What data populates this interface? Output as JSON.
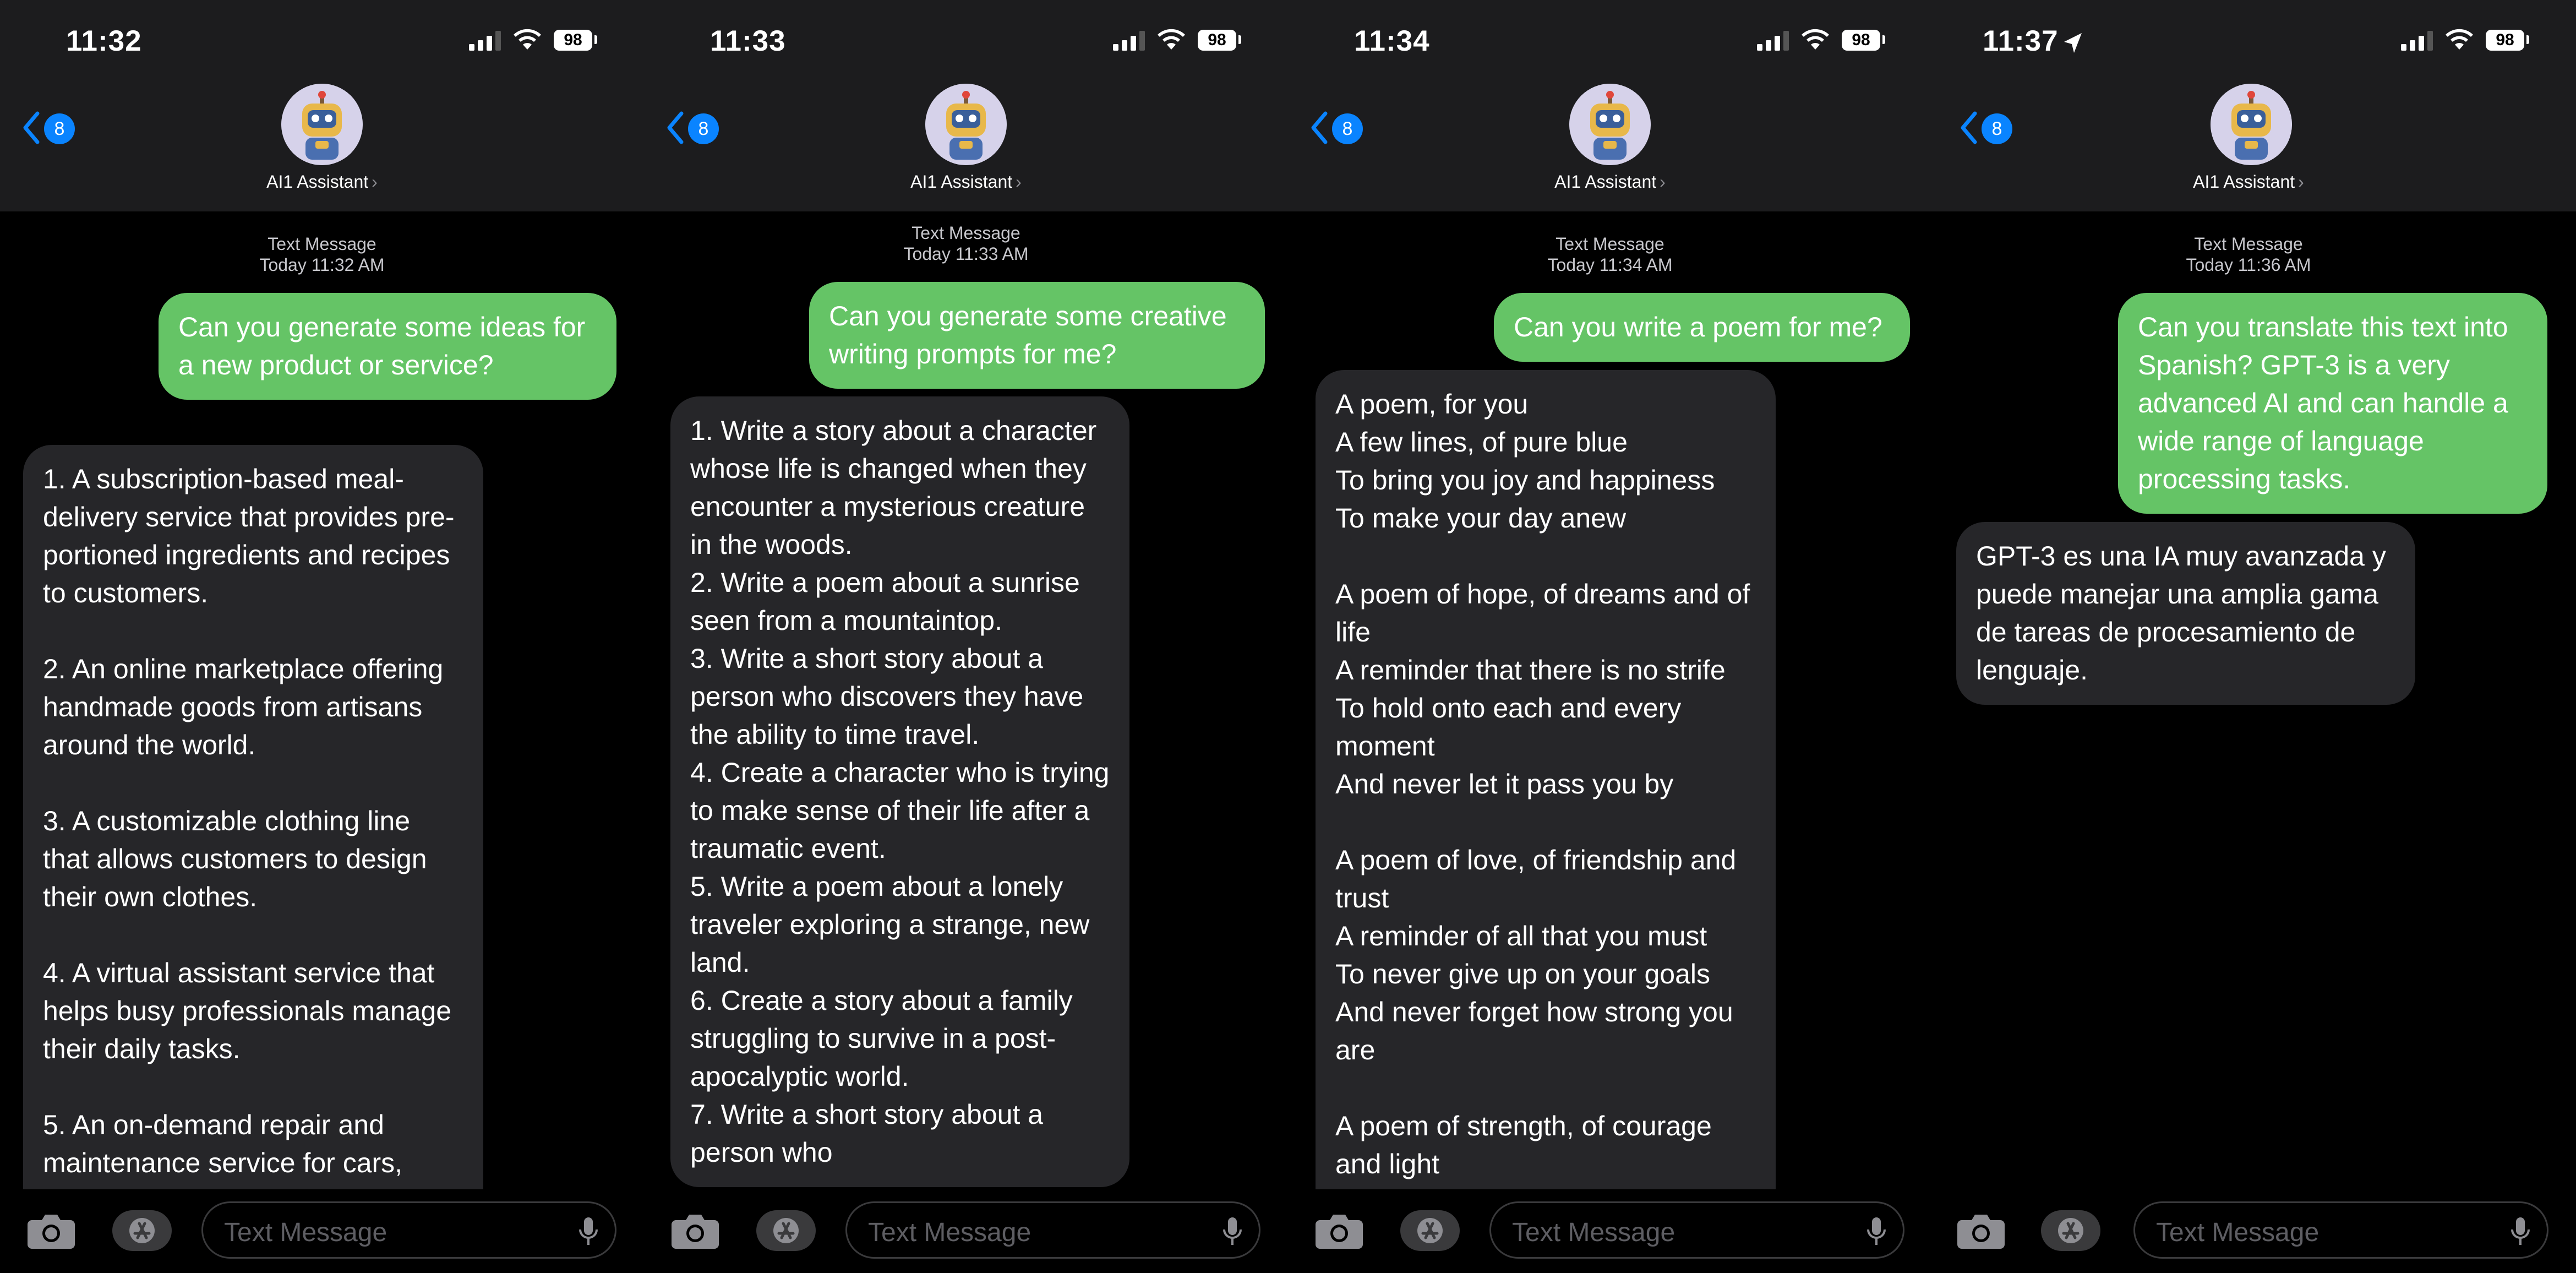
{
  "panels": [
    {
      "time": "11:32",
      "battery": "98",
      "unread": "8",
      "contact": "AI1 Assistant",
      "stamp_label": "Text Message",
      "stamp_time": "Today 11:32 AM",
      "outgoing": "Can you generate some ideas for a new product or service?",
      "incoming": "1. A subscription-based meal-delivery service that provides pre-portioned ingredients and recipes to customers.\n\n2. An online marketplace offering handmade goods from artisans around the world.\n\n3. A customizable clothing line that allows customers to design their own clothes.\n\n4. A virtual assistant service that helps busy professionals manage their daily tasks.\n\n5. An on-demand repair and maintenance service for cars, appliances, and other household",
      "placeholder": "Text Message"
    },
    {
      "time": "11:33",
      "battery": "98",
      "unread": "8",
      "contact": "AI1 Assistant",
      "stamp_label": "Text Message",
      "stamp_time": "Today 11:33 AM",
      "outgoing": "Can you generate some creative writing prompts for me?",
      "incoming": "1. Write a story about a character whose life is changed when they encounter a mysterious creature in the woods.\n2. Write a poem about a sunrise seen from a mountaintop.\n3. Write a short story about a person who discovers they have the ability to time travel.\n4. Create a character who is trying to make sense of their life after a traumatic event.\n5. Write a poem about a lonely traveler exploring a strange, new land.\n6. Create a story about a family struggling to survive in a post-apocalyptic world.\n7. Write a short story about a person who",
      "placeholder": "Text Message"
    },
    {
      "time": "11:34",
      "battery": "98",
      "unread": "8",
      "contact": "AI1 Assistant",
      "stamp_label": "Text Message",
      "stamp_time": "Today 11:34 AM",
      "outgoing": "Can you write a poem for me?",
      "incoming": "A poem, for you\nA few lines, of pure blue\nTo bring you joy and happiness\nTo make your day anew\n\nA poem of hope, of dreams and of life\nA reminder that there is no strife\nTo hold onto each and every moment\nAnd never let it pass you by\n\nA poem of love, of friendship and trust\nA reminder of all that you must\nTo never give up on your goals\nAnd never forget how strong you are\n\nA poem of strength, of courage and light\nA reminder that you can win the",
      "placeholder": "Text Message"
    },
    {
      "time": "11:37",
      "battery": "98",
      "unread": "8",
      "contact": "AI1 Assistant",
      "stamp_label": "Text Message",
      "stamp_time": "Today 11:36 AM",
      "outgoing": "Can you translate this text into Spanish? GPT-3 is a very advanced AI and can handle a wide range of language processing tasks.",
      "incoming": "GPT-3 es una IA muy avanzada y puede manejar una amplia gama de tareas de procesamiento de lenguaje.",
      "placeholder": "Text Message"
    }
  ],
  "colors": {
    "outgoing_bubble": "#65c466",
    "incoming_bubble": "#262629",
    "badge": "#0a84ff",
    "header": "#1c1c1e"
  },
  "icons": [
    "signal-icon",
    "wifi-icon",
    "location-arrow-icon",
    "back-chevron-icon",
    "camera-icon",
    "app-store-icon",
    "microphone-icon",
    "robot-avatar"
  ]
}
